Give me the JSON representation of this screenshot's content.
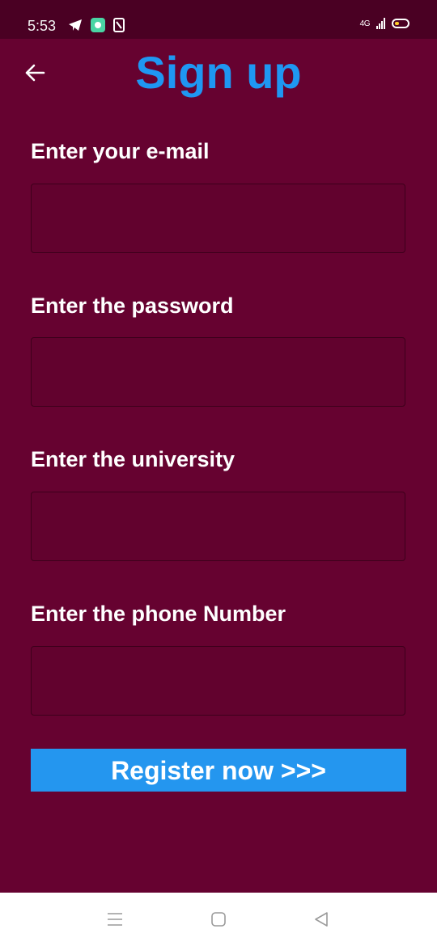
{
  "status_bar": {
    "time": "5:53",
    "network": "4G",
    "battery_color": "#ffcc2a",
    "left_icons": [
      "telegram-icon",
      "chat-bubble-icon",
      "document-icon"
    ]
  },
  "header": {
    "title": "Sign up",
    "back_icon": "arrow-left-icon"
  },
  "form": {
    "email_label": "Enter your e-mail",
    "email_value": "",
    "password_label": "Enter the password",
    "password_value": "",
    "university_label": "Enter the university",
    "university_value": "",
    "phone_label": "Enter the phone Number",
    "phone_value": "",
    "register_label": "Register now >>>"
  },
  "nav_bar": {
    "items": [
      "menu-icon",
      "home-icon",
      "back-icon"
    ]
  },
  "colors": {
    "background": "#660230",
    "status_bar": "#4a0023",
    "accent": "#1f97f2",
    "button": "#2496ef"
  }
}
